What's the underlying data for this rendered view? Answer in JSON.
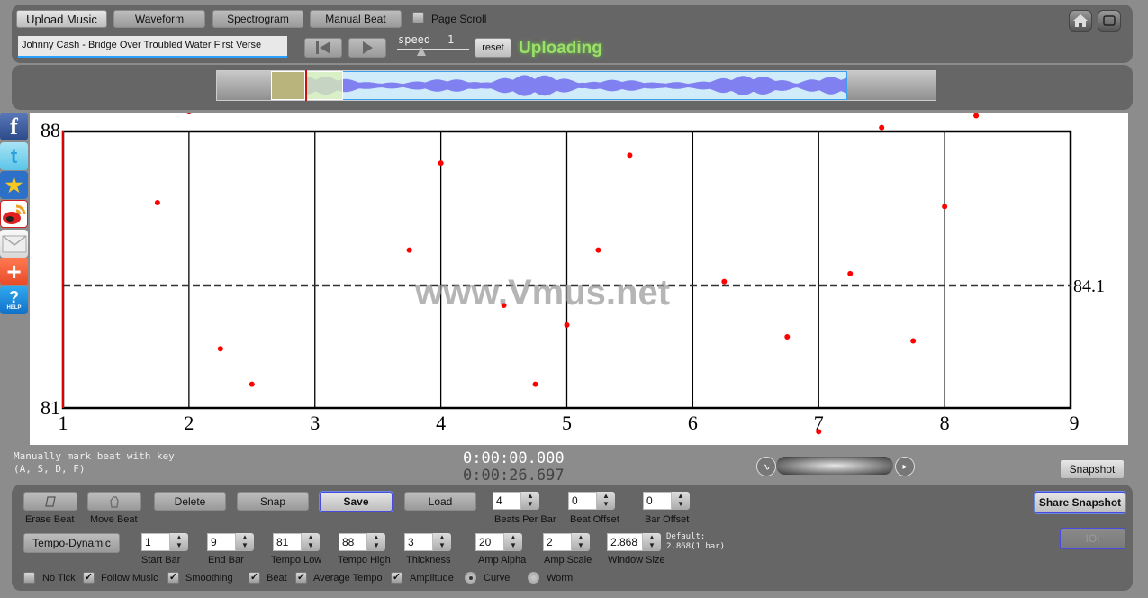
{
  "toolbar": {
    "upload_label": "Upload Music",
    "waveform_label": "Waveform",
    "spectrogram_label": "Spectrogram",
    "manual_beat_label": "Manual Beat",
    "page_scroll_label": "Page Scroll",
    "page_scroll_checked": false,
    "song_title": "Johnny Cash - Bridge Over Troubled Water First Verse",
    "speed_label": "speed",
    "speed_value": "1",
    "reset_label": "reset",
    "status": "Uploading",
    "home_icon": "home-icon",
    "fullscreen_icon": "fullscreen-icon"
  },
  "overview": {
    "playhead_fraction": 0.125,
    "waveform_color": "#8080f0"
  },
  "social": [
    "facebook-icon",
    "twitter-icon",
    "qzone-icon",
    "weibo-icon",
    "mail-icon",
    "share-plus-icon",
    "help-icon"
  ],
  "watermark": "www.Vmus.net",
  "chart_data": {
    "type": "scatter",
    "title": "",
    "xlabel": "",
    "ylabel": "",
    "xlim": [
      1,
      9
    ],
    "ylim": [
      81,
      88
    ],
    "x_ticks": [
      "1",
      "2",
      "3",
      "4",
      "5",
      "6",
      "7",
      "8",
      "9"
    ],
    "y_tick_top": "88",
    "y_tick_bottom": "81",
    "average_line": {
      "value": 84.1,
      "label": "84.1",
      "style": "dashed"
    },
    "grid": "vertical bar lines",
    "point_color": "#ff0000",
    "points": [
      {
        "x": 1.75,
        "y": 86.2
      },
      {
        "x": 2.0,
        "y": 88.5
      },
      {
        "x": 2.25,
        "y": 82.5
      },
      {
        "x": 2.5,
        "y": 81.6
      },
      {
        "x": 3.75,
        "y": 85.0
      },
      {
        "x": 4.0,
        "y": 87.2
      },
      {
        "x": 4.5,
        "y": 83.6
      },
      {
        "x": 4.75,
        "y": 81.6
      },
      {
        "x": 5.0,
        "y": 83.1
      },
      {
        "x": 5.25,
        "y": 85.0
      },
      {
        "x": 5.5,
        "y": 87.4
      },
      {
        "x": 6.25,
        "y": 84.2
      },
      {
        "x": 6.75,
        "y": 82.8
      },
      {
        "x": 7.0,
        "y": 80.4
      },
      {
        "x": 7.25,
        "y": 84.4
      },
      {
        "x": 7.5,
        "y": 88.1
      },
      {
        "x": 7.75,
        "y": 82.7
      },
      {
        "x": 8.0,
        "y": 86.1
      },
      {
        "x": 8.25,
        "y": 88.4
      }
    ]
  },
  "status_bar": {
    "hint_line1": "Manually mark beat with key",
    "hint_line2": "(A, S, D, F)",
    "current_time": "0:00:00.000",
    "total_time": "0:00:26.697",
    "snapshot_label": "Snapshot"
  },
  "controls": {
    "erase_beat_label": "Erase Beat",
    "move_beat_label": "Move Beat",
    "delete_label": "Delete",
    "snap_label": "Snap",
    "save_label": "Save",
    "load_label": "Load",
    "beats_per_bar": {
      "label": "Beats Per Bar",
      "value": "4"
    },
    "beat_offset": {
      "label": "Beat Offset",
      "value": "0"
    },
    "bar_offset": {
      "label": "Bar Offset",
      "value": "0"
    },
    "share_snapshot_label": "Share Snapshot",
    "tempo_dynamic_label": "Tempo-Dynamic",
    "start_bar": {
      "label": "Start Bar",
      "value": "1"
    },
    "end_bar": {
      "label": "End Bar",
      "value": "9"
    },
    "tempo_low": {
      "label": "Tempo Low",
      "value": "81"
    },
    "tempo_high": {
      "label": "Tempo High",
      "value": "88"
    },
    "thickness": {
      "label": "Thickness",
      "value": "3"
    },
    "amp_alpha": {
      "label": "Amp Alpha",
      "value": "20"
    },
    "amp_scale": {
      "label": "Amp Scale",
      "value": "2"
    },
    "window_size": {
      "label": "Window Size",
      "value": "2.868"
    },
    "default_line1": "Default:",
    "default_line2": "2.868(1 bar)",
    "ioi_label": "IOI",
    "checkboxes": [
      {
        "label": "No Tick",
        "checked": false
      },
      {
        "label": "Follow Music",
        "checked": true
      },
      {
        "label": "Smoothing",
        "checked": true
      },
      {
        "label": "Beat",
        "checked": true
      },
      {
        "label": "Average Tempo",
        "checked": true
      },
      {
        "label": "Amplitude",
        "checked": true
      }
    ],
    "radios": [
      {
        "label": "Curve",
        "selected": true
      },
      {
        "label": "Worm",
        "selected": false
      }
    ]
  }
}
